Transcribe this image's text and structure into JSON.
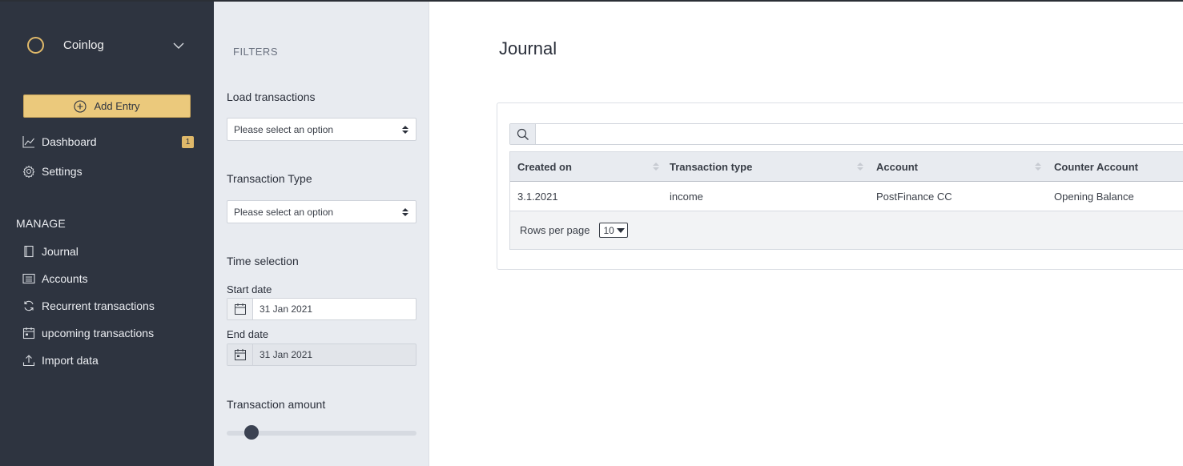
{
  "brand": {
    "name": "Coinlog"
  },
  "sidebar": {
    "add_entry_label": "Add Entry",
    "top_items": [
      {
        "label": "Dashboard",
        "icon": "chart-line-icon",
        "badge": "1"
      },
      {
        "label": "Settings",
        "icon": "gear-icon"
      }
    ],
    "section_label": "MANAGE",
    "manage_items": [
      {
        "label": "Journal",
        "icon": "book-icon"
      },
      {
        "label": "Accounts",
        "icon": "list-icon"
      },
      {
        "label": "Recurrent transactions",
        "icon": "refresh-icon"
      },
      {
        "label": "upcoming transactions",
        "icon": "calendar-icon"
      },
      {
        "label": "Import data",
        "icon": "upload-icon"
      }
    ]
  },
  "filters": {
    "title": "FILTERS",
    "load_transactions": {
      "label": "Load transactions",
      "value": "Please select an option"
    },
    "transaction_type": {
      "label": "Transaction Type",
      "value": "Please select an option"
    },
    "time_selection": {
      "label": "Time selection",
      "start_label": "Start date",
      "start_value": "31 Jan 2021",
      "end_label": "End date",
      "end_value": "31 Jan 2021"
    },
    "transaction_amount": {
      "label": "Transaction amount",
      "slider_fraction": 0.13
    }
  },
  "main": {
    "title": "Journal",
    "search": {
      "value": ""
    },
    "table": {
      "columns": [
        "Created on",
        "Transaction type",
        "Account",
        "Counter Account"
      ],
      "rows": [
        [
          "3.1.2021",
          "income",
          "PostFinance CC",
          "Opening Balance"
        ]
      ],
      "rows_per_page_label": "Rows per page",
      "rows_per_page_value": "10"
    }
  },
  "colors": {
    "sidebar_bg": "#2e3440",
    "accent": "#ebc97c",
    "filters_bg": "#e8ebf0"
  }
}
